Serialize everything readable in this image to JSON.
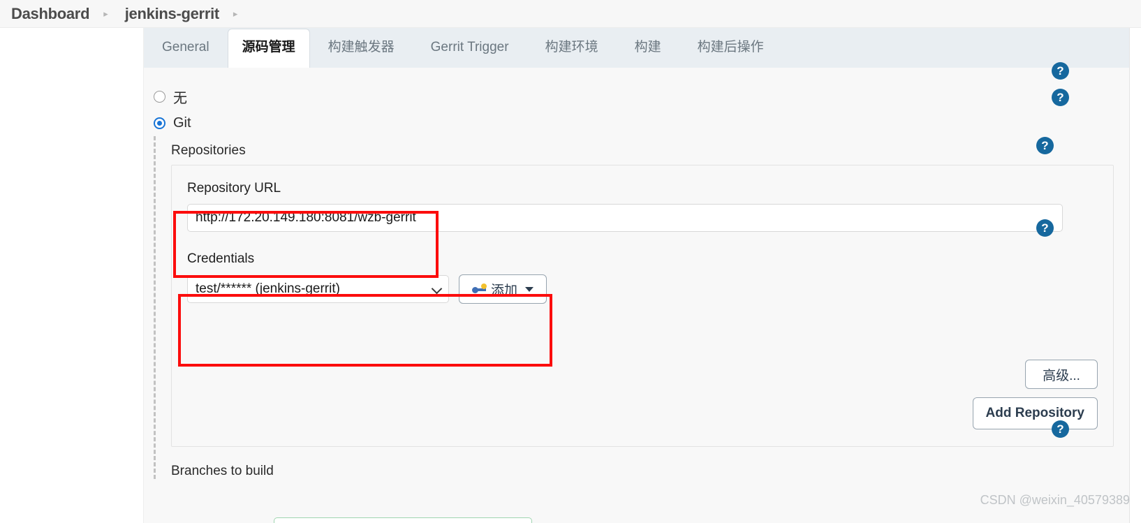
{
  "breadcrumb": {
    "items": [
      {
        "label": "Dashboard"
      },
      {
        "label": "jenkins-gerrit"
      }
    ],
    "separator": "▸"
  },
  "tabs": [
    {
      "label": "General",
      "active": false
    },
    {
      "label": "源码管理",
      "active": true
    },
    {
      "label": "构建触发器",
      "active": false
    },
    {
      "label": "Gerrit Trigger",
      "active": false
    },
    {
      "label": "构建环境",
      "active": false
    },
    {
      "label": "构建",
      "active": false
    },
    {
      "label": "构建后操作",
      "active": false
    }
  ],
  "scm": {
    "options": [
      {
        "label": "无",
        "selected": false
      },
      {
        "label": "Git",
        "selected": true
      }
    ],
    "repositories_title": "Repositories",
    "repository": {
      "url_label": "Repository URL",
      "url_value": "http://172.20.149.180:8081/wzb-gerrit",
      "url_placeholder": "",
      "credentials_label": "Credentials",
      "credentials_value": "test/****** (jenkins-gerrit)",
      "add_button_label": "添加",
      "advanced_button_label": "高级...",
      "add_repository_button_label": "Add Repository"
    },
    "branches_label": "Branches to build"
  },
  "help_icon_glyph": "?",
  "watermark": "CSDN @weixin_40579389",
  "colors": {
    "accent_blue": "#1874d6",
    "help_blue": "#16689e",
    "annotation_red": "#fc0d0d",
    "tabbar_bg": "#e9eef2",
    "content_bg": "#f8f8f8"
  }
}
